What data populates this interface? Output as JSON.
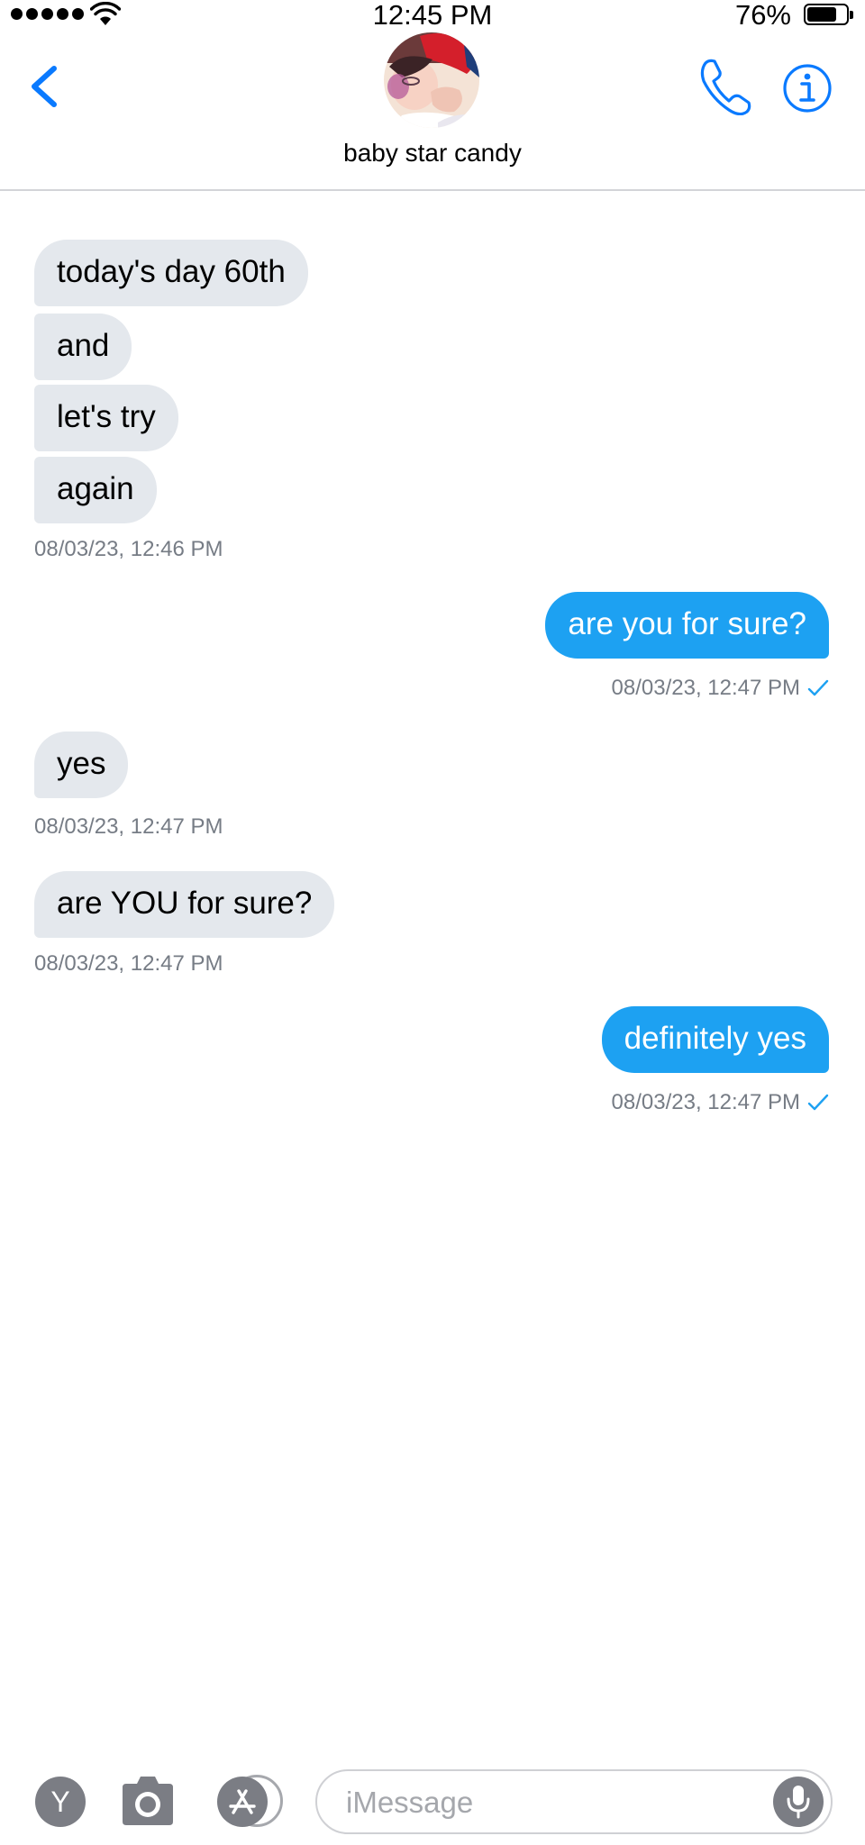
{
  "status_bar": {
    "time": "12:45 PM",
    "battery_percent_label": "76%",
    "battery_level": 0.76,
    "signal_dots": 5,
    "wifi_icon": "wifi-icon"
  },
  "header": {
    "back_icon": "chevron-left-icon",
    "contact_name": "baby star candy",
    "call_icon": "phone-icon",
    "info_icon": "info-icon"
  },
  "messages": [
    {
      "direction": "in",
      "text": "today's day 60th"
    },
    {
      "direction": "in",
      "text": "and"
    },
    {
      "direction": "in",
      "text": "let's try"
    },
    {
      "direction": "in",
      "text": "again"
    },
    {
      "direction": "in",
      "timestamp": "08/03/23, 12:46 PM"
    },
    {
      "direction": "out",
      "text": "are you for sure?"
    },
    {
      "direction": "out",
      "timestamp": "08/03/23, 12:47 PM",
      "read": true
    },
    {
      "direction": "in",
      "text": "yes"
    },
    {
      "direction": "in",
      "timestamp": "08/03/23, 12:47 PM"
    },
    {
      "direction": "in",
      "text": "are YOU for sure?"
    },
    {
      "direction": "in",
      "timestamp": "08/03/23, 12:47 PM"
    },
    {
      "direction": "out",
      "text": "definitely yes"
    },
    {
      "direction": "out",
      "timestamp": "08/03/23, 12:47 PM",
      "read": true
    }
  ],
  "input_bar": {
    "y_button_label": "Y",
    "camera_icon": "camera-icon",
    "apps_icon": "app-store-icon",
    "placeholder": "iMessage",
    "value": "",
    "mic_icon": "microphone-icon"
  },
  "colors": {
    "accent": "#0a7aff",
    "outgoing_bubble": "#1da1f2",
    "incoming_bubble": "#e4e8ed",
    "timestamp": "#767c85",
    "read_check": "#1da1f2"
  }
}
